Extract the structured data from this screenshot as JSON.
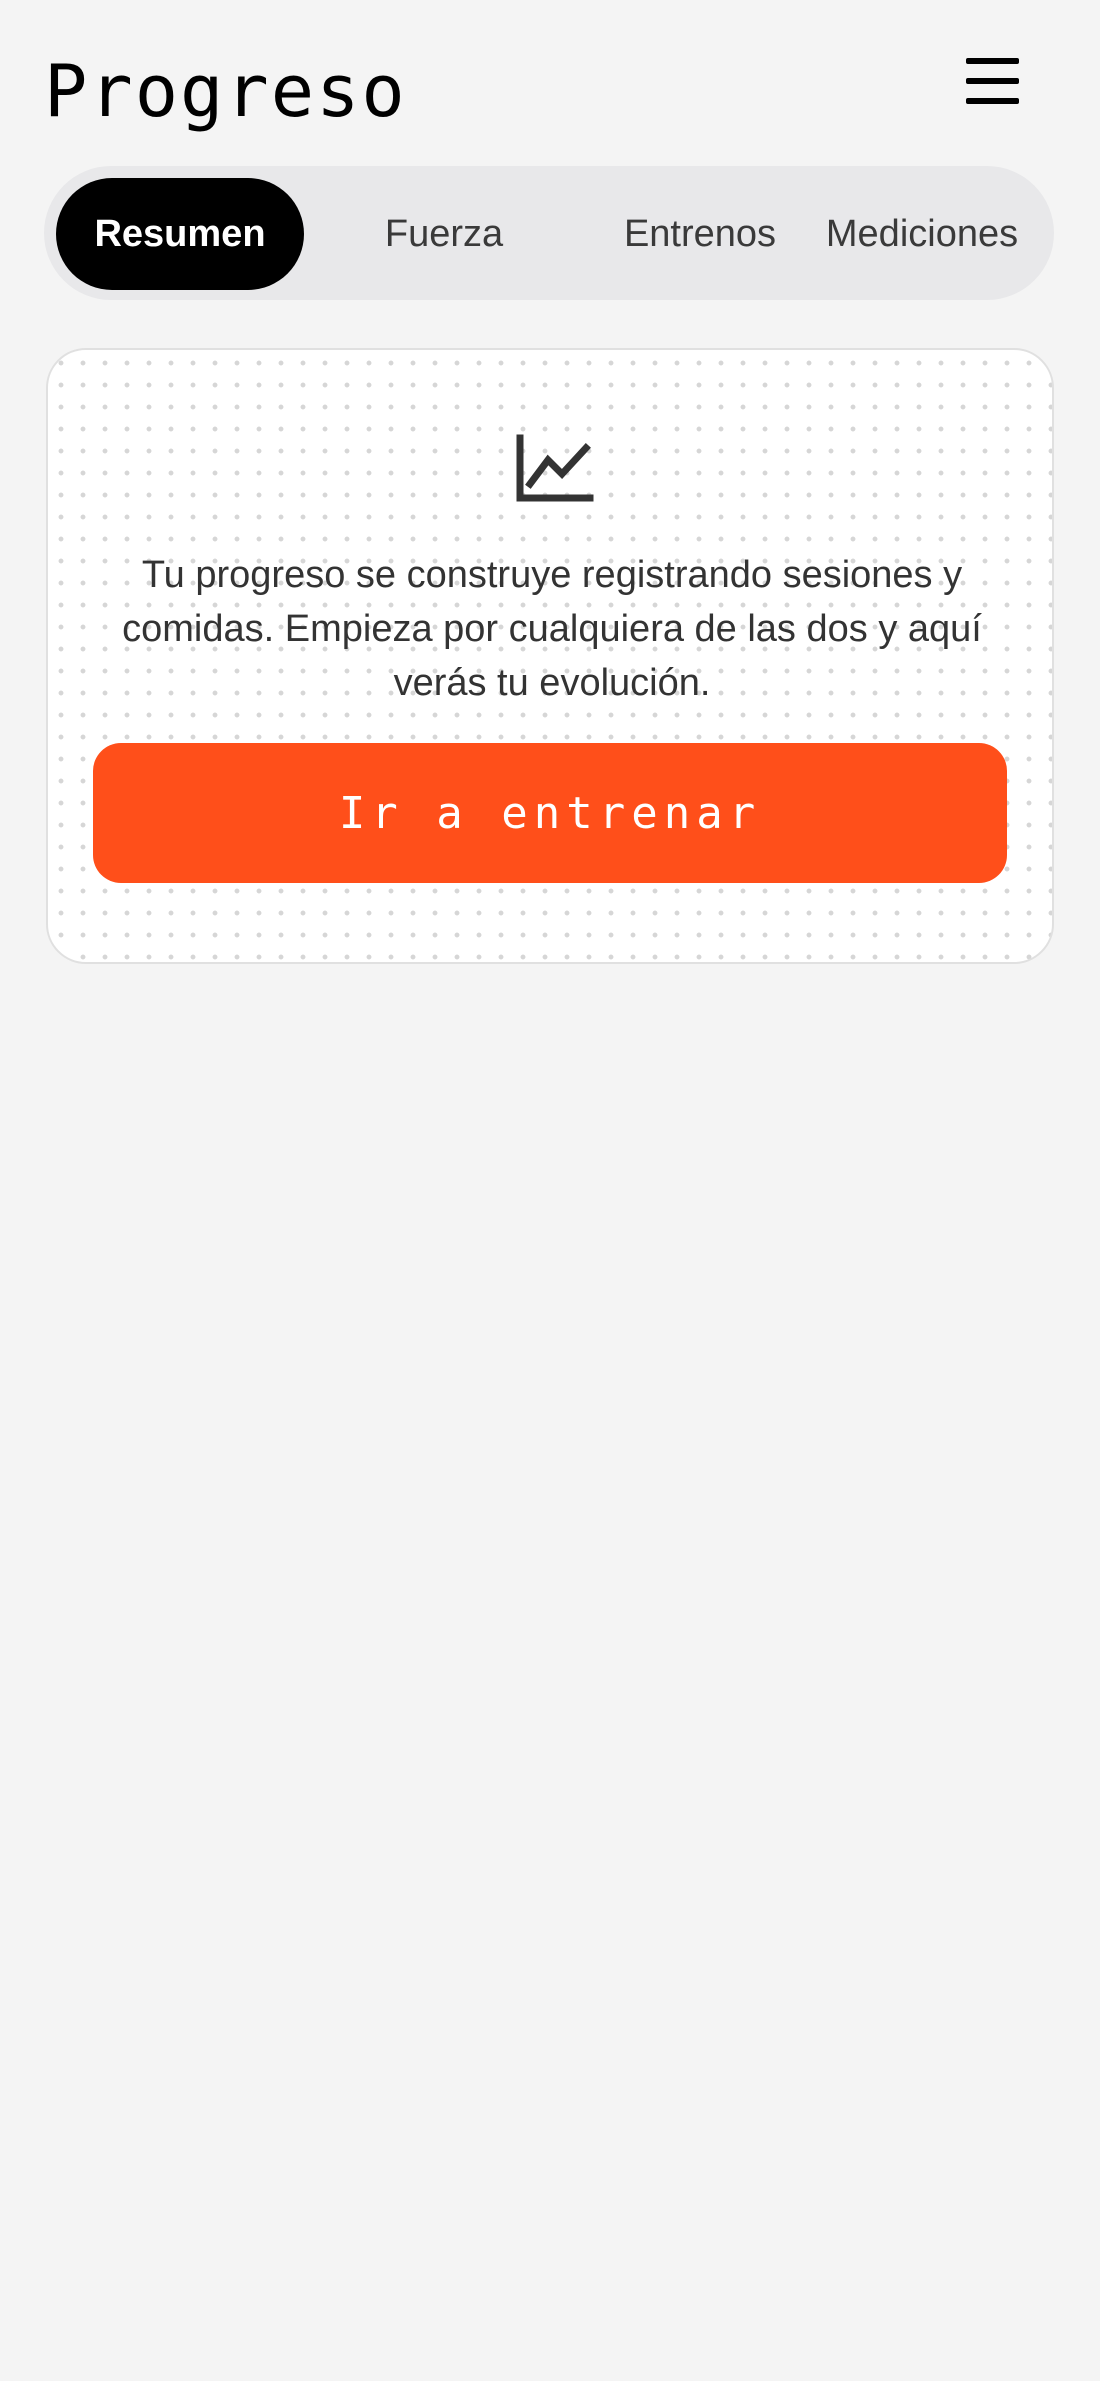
{
  "header": {
    "title": "Progreso",
    "menu_icon": "hamburger-menu-icon"
  },
  "tabs": [
    {
      "label": "Resumen",
      "active": true
    },
    {
      "label": "Fuerza",
      "active": false
    },
    {
      "label": "Entrenos",
      "active": false
    },
    {
      "label": "Mediciones",
      "active": false
    }
  ],
  "empty_state": {
    "icon": "line-chart-icon",
    "message": "Tu progreso se construye registrando sesiones y comidas. Empieza por cualquiera de las dos y aquí verás tu evolución.",
    "cta_label": "Ir a entrenar"
  },
  "colors": {
    "accent": "#ff4f1a",
    "background": "#f4f4f4",
    "active_tab": "#000000",
    "tab_bar": "#e8e8ea"
  }
}
